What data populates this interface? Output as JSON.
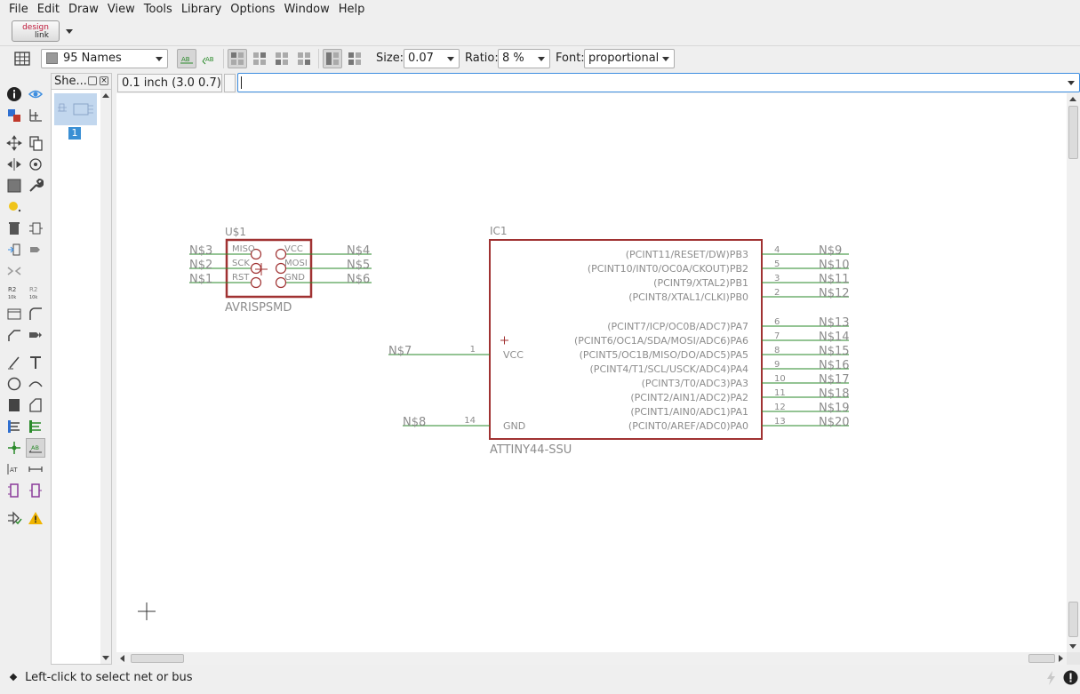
{
  "menu": [
    "File",
    "Edit",
    "Draw",
    "View",
    "Tools",
    "Library",
    "Options",
    "Window",
    "Help"
  ],
  "logo": {
    "line1": "design",
    "line2": "link"
  },
  "toolbar": {
    "layer_select": "95 Names",
    "size_label": "Size:",
    "size_value": "0.07",
    "ratio_label": "Ratio:",
    "ratio_value": "8 %",
    "font_label": "Font:",
    "font_value": "proportional"
  },
  "sheets": {
    "title": "She...",
    "current": "1"
  },
  "coord": "0.1 inch (3.0 0.7)",
  "command_value": "",
  "status": "Left-click to select net or bus",
  "colors": {
    "part": "#a03232",
    "net": "#2a8a2a",
    "text": "#8c8c8c",
    "accent": "#3d8ee0"
  },
  "schematic": {
    "u1": {
      "name": "U$1",
      "value": "AVRISPSMD",
      "pins_left": [
        "MISO",
        "SCK",
        "RST"
      ],
      "pins_right": [
        "VCC",
        "MOSI",
        "GND"
      ],
      "nets_left": [
        "N$3",
        "N$2",
        "N$1"
      ],
      "nets_right": [
        "N$4",
        "N$5",
        "N$6"
      ]
    },
    "ic1": {
      "name": "IC1",
      "value": "ATTINY44-SSU",
      "left_pins": [
        {
          "label": "VCC",
          "num": "1",
          "net": "N$7"
        },
        {
          "label": "GND",
          "num": "14",
          "net": "N$8"
        }
      ],
      "right_pins": [
        {
          "label": "(PCINT11/RESET/DW)PB3",
          "num": "4",
          "net": "N$9"
        },
        {
          "label": "(PCINT10/INT0/OC0A/CKOUT)PB2",
          "num": "5",
          "net": "N$10"
        },
        {
          "label": "(PCINT9/XTAL2)PB1",
          "num": "3",
          "net": "N$11"
        },
        {
          "label": "(PCINT8/XTAL1/CLKI)PB0",
          "num": "2",
          "net": "N$12"
        },
        {
          "label": "(PCINT7/ICP/OC0B/ADC7)PA7",
          "num": "6",
          "net": "N$13"
        },
        {
          "label": "(PCINT6/OC1A/SDA/MOSI/ADC6)PA6",
          "num": "7",
          "net": "N$14"
        },
        {
          "label": "(PCINT5/OC1B/MISO/DO/ADC5)PA5",
          "num": "8",
          "net": "N$15"
        },
        {
          "label": "(PCINT4/T1/SCL/USCK/ADC4)PA4",
          "num": "9",
          "net": "N$16"
        },
        {
          "label": "(PCINT3/T0/ADC3)PA3",
          "num": "10",
          "net": "N$17"
        },
        {
          "label": "(PCINT2/AIN1/ADC2)PA2",
          "num": "11",
          "net": "N$18"
        },
        {
          "label": "(PCINT1/AIN0/ADC1)PA1",
          "num": "12",
          "net": "N$19"
        },
        {
          "label": "(PCINT0/AREF/ADC0)PA0",
          "num": "13",
          "net": "N$20"
        }
      ]
    }
  },
  "left_tools": [
    "info-icon",
    "eye-icon",
    "layers-icon",
    "mark-icon",
    "move-icon",
    "copy-icon",
    "mirror-icon",
    "rotate-icon",
    "group-icon",
    "wrench-icon",
    "bulb-icon",
    "delete-icon",
    "add-icon",
    "replace-icon",
    "gate-swap-icon",
    "pin-swap-icon",
    "name-icon",
    "value-icon",
    "split-icon",
    "smash-icon",
    "miter-icon",
    "invoke-icon",
    "line-icon",
    "text-icon",
    "circle-icon",
    "arc-icon",
    "rect-icon",
    "polygon-icon",
    "bus-icon",
    "net-icon",
    "junction-icon",
    "label-icon",
    "attribute-icon",
    "dimension-icon",
    "frame-icon",
    "frame-b-icon",
    "erc-icon",
    "warning-icon"
  ]
}
